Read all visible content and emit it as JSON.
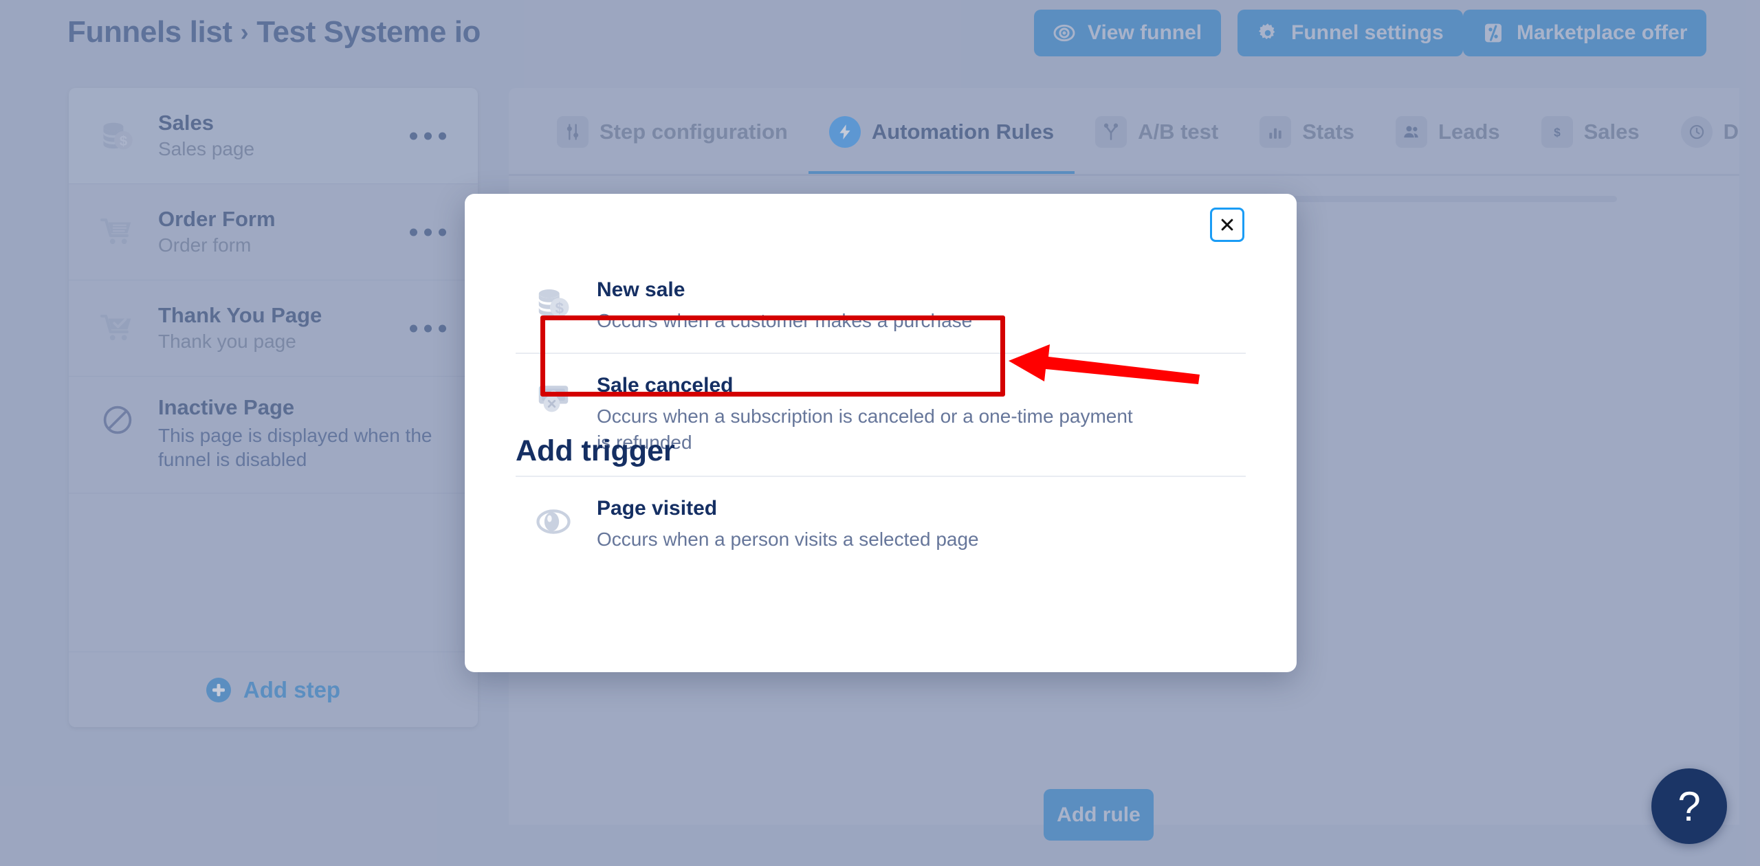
{
  "header": {
    "breadcrumb_root": "Funnels list",
    "breadcrumb_sep": "›",
    "breadcrumb_current": "Test Systeme io",
    "buttons": [
      {
        "label": "View funnel",
        "icon": "eye-icon"
      },
      {
        "label": "Funnel settings",
        "icon": "gear-icon"
      },
      {
        "label": "Marketplace offer",
        "icon": "percent-tag-icon"
      }
    ]
  },
  "sidebar": {
    "steps": [
      {
        "title": "Sales",
        "subtitle": "Sales page",
        "icon": "coins-dollar-icon",
        "selected": true
      },
      {
        "title": "Order Form",
        "subtitle": "Order form",
        "icon": "shopping-cart-icon",
        "selected": false
      },
      {
        "title": "Thank You Page",
        "subtitle": "Thank you page",
        "icon": "cart-check-icon",
        "selected": false
      }
    ],
    "inactive": {
      "title": "Inactive Page",
      "subtitle": "This page is displayed when the funnel is disabled",
      "icon": "no-entry-icon"
    },
    "add_step_label": "Add step",
    "more_menu_label": "•••"
  },
  "main": {
    "tabs": [
      {
        "label": "Step configuration",
        "icon": "sliders-icon",
        "active": false
      },
      {
        "label": "Automation Rules",
        "icon": "lightning-bolt-icon",
        "active": true
      },
      {
        "label": "A/B test",
        "icon": "split-branch-icon",
        "active": false
      },
      {
        "label": "Stats",
        "icon": "bar-chart-icon",
        "active": false
      },
      {
        "label": "Leads",
        "icon": "people-icon",
        "active": false
      },
      {
        "label": "Sales",
        "icon": "dollar-sign-icon",
        "active": false
      },
      {
        "label": "Deadline s",
        "icon": "clock-icon",
        "active": false
      }
    ],
    "add_rule_label": "Add rule",
    "help_label": "?"
  },
  "modal": {
    "title": "Add trigger",
    "close_label": "×",
    "triggers": [
      {
        "title": "New sale",
        "subtitle": "Occurs when a customer makes a purchase",
        "icon": "coins-dollar-icon",
        "highlighted": true
      },
      {
        "title": "Sale canceled",
        "subtitle": "Occurs when a subscription is canceled or a one-time payment is refunded",
        "icon": "money-cancel-icon",
        "highlighted": false
      },
      {
        "title": "Page visited",
        "subtitle": "Occurs when a person visits a selected page",
        "icon": "eye-icon",
        "highlighted": false
      }
    ]
  },
  "annotations": {
    "highlight_color": "#d40000",
    "arrow_color": "#ff0000"
  },
  "colors": {
    "accent_blue": "#1579c8",
    "dark_navy": "#152f63",
    "page_bg": "#a3aec8",
    "panel_bg": "#aab4cd"
  }
}
